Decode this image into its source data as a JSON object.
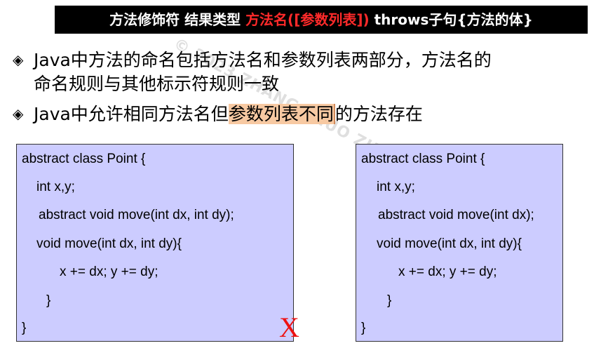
{
  "header": {
    "part1": "方法修饰符 结果类型 ",
    "part2": "方法名([参数列表])",
    "part3": " throws子句{方法的体}"
  },
  "bullets": [
    {
      "line1": "Java中方法的命名包括方法名和参数列表两部分，方法名的",
      "line2": "命名规则与其他标示符规则一致"
    },
    {
      "pre": "Java中允许相同方法名但",
      "highlight": "参数列表不同",
      "post": "的方法存在"
    }
  ],
  "bullet_icon": "diamond-bullet-icon",
  "watermark": "© 2023 ZHANG ZHUO ZHANG Jia",
  "code_left": [
    "abstract class Point {",
    "int x,y;",
    "abstract void move(int dx, int dy);",
    "void move(int dx, int dy){",
    "x += dx; y += dy;",
    "}",
    "}"
  ],
  "code_right": [
    "abstract class Point {",
    "int x,y;",
    "abstract void move(int dx);",
    "void move(int dx, int dy){",
    "x += dx; y += dy;",
    "}",
    "}"
  ],
  "invalid_mark": "X",
  "colors": {
    "header_bg": "#000000",
    "header_accent": "#ff2a2a",
    "code_bg": "#ccccff",
    "highlight_bg": "#f7c9a2",
    "invalid_mark": "#ee1111"
  }
}
